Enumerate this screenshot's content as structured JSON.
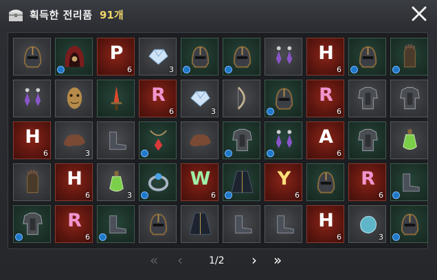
{
  "header": {
    "title": "획득한 전리품",
    "count": "91개"
  },
  "pager": {
    "first": "«",
    "prev": "‹",
    "page": "1/2",
    "next": "›",
    "last": "»"
  },
  "colors": {
    "accent": "#f2d66a",
    "badge": "#1f78c8",
    "green_bg": "#1c3229",
    "red_bg": "#5d160f"
  },
  "slots": [
    {
      "bg": "gray",
      "icon": "helmet-icon"
    },
    {
      "bg": "green",
      "icon": "hood-icon",
      "badge": true
    },
    {
      "bg": "red",
      "letter": "P",
      "color": "white",
      "qty": "6"
    },
    {
      "bg": "gray",
      "icon": "gem-icon",
      "qty": "3"
    },
    {
      "bg": "green",
      "icon": "helmet-icon",
      "badge": true
    },
    {
      "bg": "green",
      "icon": "helmet-icon",
      "badge": true
    },
    {
      "bg": "gray",
      "icon": "earring-icon"
    },
    {
      "bg": "red",
      "letter": "H",
      "color": "white",
      "qty": "6"
    },
    {
      "bg": "green",
      "icon": "helmet-icon",
      "badge": true
    },
    {
      "bg": "green",
      "icon": "gauntlet-icon",
      "badge": true
    },
    {
      "bg": "gray",
      "icon": "earring-icon"
    },
    {
      "bg": "gray",
      "icon": "mask-icon"
    },
    {
      "bg": "green",
      "icon": "sword-icon"
    },
    {
      "bg": "red",
      "letter": "R",
      "color": "pink",
      "qty": "6"
    },
    {
      "bg": "gray",
      "icon": "gem-icon",
      "qty": "3"
    },
    {
      "bg": "gray",
      "icon": "bow-icon"
    },
    {
      "bg": "green",
      "icon": "helmet-icon",
      "badge": true
    },
    {
      "bg": "red",
      "letter": "R",
      "color": "pink",
      "qty": "6"
    },
    {
      "bg": "gray",
      "icon": "armor-icon"
    },
    {
      "bg": "gray",
      "icon": "armor-icon"
    },
    {
      "bg": "red",
      "letter": "H",
      "color": "white",
      "qty": "6"
    },
    {
      "bg": "gray",
      "icon": "leather-icon",
      "qty": "3"
    },
    {
      "bg": "gray",
      "icon": "boots-icon"
    },
    {
      "bg": "green",
      "icon": "necklace-icon",
      "badge": true
    },
    {
      "bg": "gray",
      "icon": "leather-icon"
    },
    {
      "bg": "green",
      "icon": "armor-icon",
      "badge": true
    },
    {
      "bg": "green",
      "icon": "earring-icon",
      "badge": true
    },
    {
      "bg": "red",
      "letter": "A",
      "color": "white",
      "qty": "6"
    },
    {
      "bg": "green",
      "icon": "armor-icon"
    },
    {
      "bg": "gray",
      "icon": "potion-icon"
    },
    {
      "bg": "gray",
      "icon": "gauntlet-icon"
    },
    {
      "bg": "red",
      "letter": "H",
      "color": "white",
      "qty": "6"
    },
    {
      "bg": "gray",
      "icon": "potion-icon",
      "qty": "3"
    },
    {
      "bg": "green",
      "icon": "ring-icon",
      "badge": true
    },
    {
      "bg": "red",
      "letter": "W",
      "color": "green",
      "qty": "6"
    },
    {
      "bg": "green",
      "icon": "cloak-icon",
      "badge": true
    },
    {
      "bg": "red",
      "letter": "Y",
      "color": "yellow",
      "qty": "6"
    },
    {
      "bg": "green",
      "icon": "helmet-icon"
    },
    {
      "bg": "red",
      "letter": "R",
      "color": "pink",
      "qty": "6"
    },
    {
      "bg": "green",
      "icon": "boots-icon",
      "badge": true
    },
    {
      "bg": "green",
      "icon": "armor-icon",
      "badge": true
    },
    {
      "bg": "red",
      "letter": "R",
      "color": "pink",
      "qty": "6"
    },
    {
      "bg": "green",
      "icon": "boots-icon",
      "badge": true
    },
    {
      "bg": "gray",
      "icon": "helmet-icon"
    },
    {
      "bg": "gray",
      "icon": "cloak-icon"
    },
    {
      "bg": "gray",
      "icon": "boots-icon"
    },
    {
      "bg": "gray",
      "icon": "boots-icon"
    },
    {
      "bg": "red",
      "letter": "H",
      "color": "white",
      "qty": "6"
    },
    {
      "bg": "gray",
      "icon": "stone-icon",
      "qty": "3"
    },
    {
      "bg": "green",
      "icon": "helmet-icon",
      "badge": true
    }
  ]
}
